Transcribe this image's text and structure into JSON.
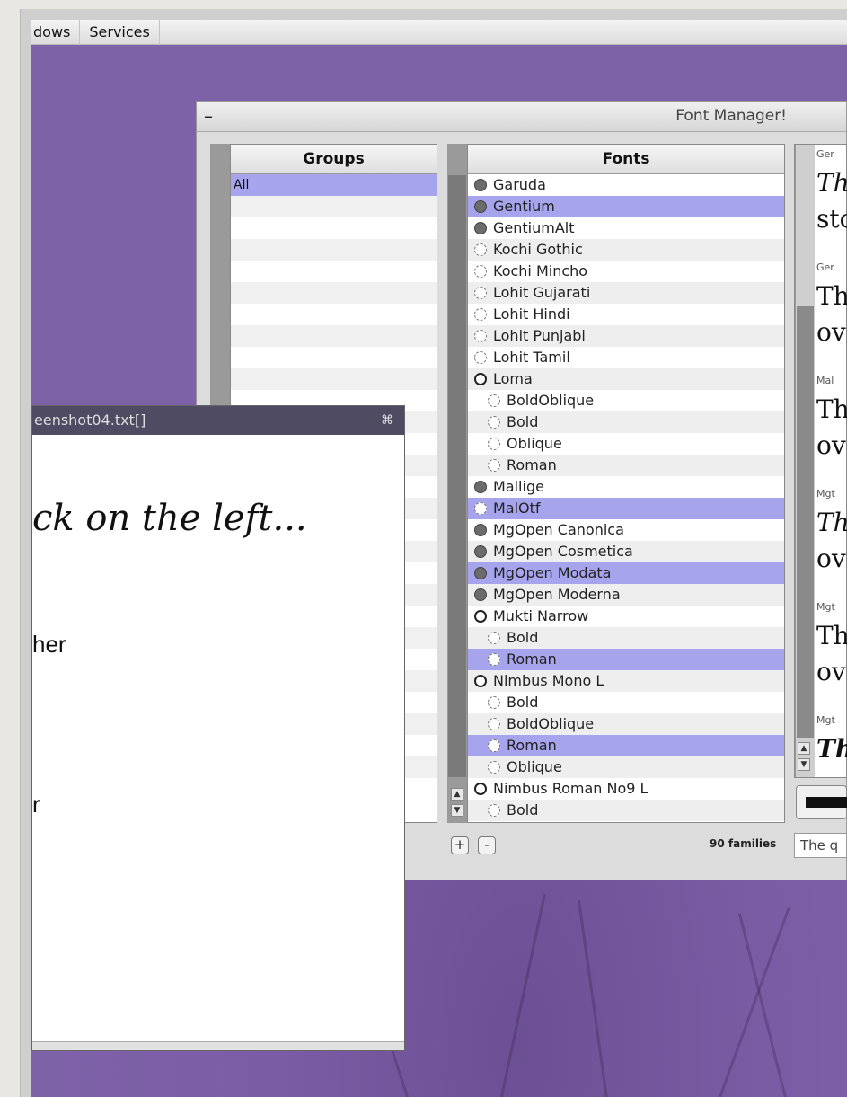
{
  "menubar": {
    "items": [
      "dows",
      "Services"
    ]
  },
  "font_manager": {
    "title": "Font Manager!",
    "minimize_glyph": "–",
    "groups": {
      "header": "Groups",
      "items": [
        "All"
      ]
    },
    "fonts": {
      "header": "Fonts",
      "items": [
        {
          "label": "Garuda",
          "icon": "filled"
        },
        {
          "label": "Gentium",
          "icon": "filled",
          "selected": true
        },
        {
          "label": "GentiumAlt",
          "icon": "filled"
        },
        {
          "label": "Kochi Gothic",
          "icon": "faint"
        },
        {
          "label": "Kochi Mincho",
          "icon": "faint"
        },
        {
          "label": "Lohit Gujarati",
          "icon": "faint"
        },
        {
          "label": "Lohit Hindi",
          "icon": "faint"
        },
        {
          "label": "Lohit Punjabi",
          "icon": "faint"
        },
        {
          "label": "Lohit Tamil",
          "icon": "faint"
        },
        {
          "label": "Loma",
          "icon": "ring"
        },
        {
          "label": "BoldOblique",
          "icon": "faint",
          "sub": true
        },
        {
          "label": "Bold",
          "icon": "faint",
          "sub": true
        },
        {
          "label": "Oblique",
          "icon": "faint",
          "sub": true
        },
        {
          "label": "Roman",
          "icon": "faint",
          "sub": true
        },
        {
          "label": "Mallige",
          "icon": "filled"
        },
        {
          "label": "MalOtf",
          "icon": "faint",
          "selected": true
        },
        {
          "label": "MgOpen Canonica",
          "icon": "filled"
        },
        {
          "label": "MgOpen Cosmetica",
          "icon": "filled"
        },
        {
          "label": "MgOpen Modata",
          "icon": "filled",
          "selected": true
        },
        {
          "label": "MgOpen Moderna",
          "icon": "filled"
        },
        {
          "label": "Mukti Narrow",
          "icon": "ring"
        },
        {
          "label": "Bold",
          "icon": "faint",
          "sub": true
        },
        {
          "label": "Roman",
          "icon": "faint",
          "sub": true,
          "selected": true
        },
        {
          "label": "Nimbus Mono L",
          "icon": "ring"
        },
        {
          "label": "Bold",
          "icon": "faint",
          "sub": true
        },
        {
          "label": "BoldOblique",
          "icon": "faint",
          "sub": true
        },
        {
          "label": "Roman",
          "icon": "faint",
          "sub": true,
          "selected": true
        },
        {
          "label": "Oblique",
          "icon": "faint",
          "sub": true
        },
        {
          "label": "Nimbus Roman No9 L",
          "icon": "ring"
        },
        {
          "label": "Bold",
          "icon": "faint",
          "sub": true
        }
      ]
    },
    "preview": {
      "entries": [
        {
          "label": "Ger",
          "line1": "Th",
          "line2": "sto"
        },
        {
          "label": "Ger",
          "line1": "Th",
          "line2": "ov"
        },
        {
          "label": "Mal",
          "line1": "Th",
          "line2": "ov"
        },
        {
          "label": "Mgt",
          "line1": "Th",
          "line2": "ov"
        },
        {
          "label": "Mgt",
          "line1": "Th",
          "line2": "ov"
        },
        {
          "label": "Mgt",
          "line1": "Th",
          "line2": ""
        }
      ]
    },
    "add_label": "+",
    "remove_label": "-",
    "families_count": "90 families",
    "sample_text": "The q"
  },
  "editor": {
    "title": "eenshot04.txt[]",
    "close_glyph": "⌘",
    "lines": [
      "ck on the left...",
      "her",
      "r"
    ]
  },
  "colors": {
    "desktop": "#7b5fa6",
    "selection": "#a7a4ee"
  }
}
